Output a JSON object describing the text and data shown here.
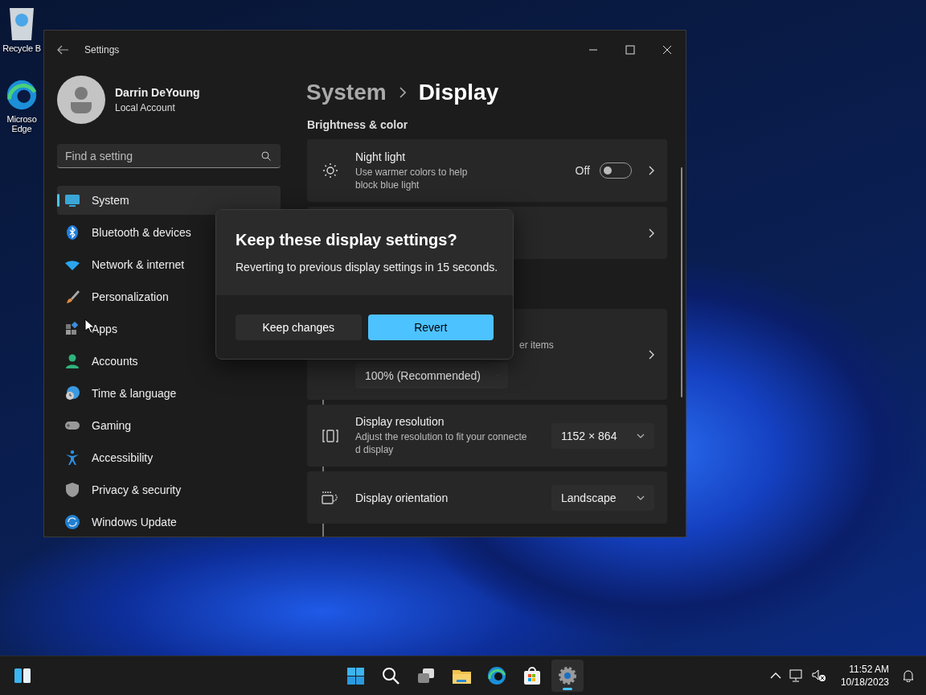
{
  "desktop_icons": [
    {
      "label": "Recycle B"
    },
    {
      "label": "Microso\nEdge"
    }
  ],
  "window": {
    "title": "Settings"
  },
  "user": {
    "name": "Darrin DeYoung",
    "account_type": "Local Account"
  },
  "search": {
    "placeholder": "Find a setting"
  },
  "nav_items": [
    {
      "label": "System",
      "selected": true
    },
    {
      "label": "Bluetooth & devices",
      "selected": false
    },
    {
      "label": "Network & internet",
      "selected": false
    },
    {
      "label": "Personalization",
      "selected": false
    },
    {
      "label": "Apps",
      "selected": false
    },
    {
      "label": "Accounts",
      "selected": false
    },
    {
      "label": "Time & language",
      "selected": false
    },
    {
      "label": "Gaming",
      "selected": false
    },
    {
      "label": "Accessibility",
      "selected": false
    },
    {
      "label": "Privacy & security",
      "selected": false
    },
    {
      "label": "Windows Update",
      "selected": false
    }
  ],
  "breadcrumb": [
    "System",
    "Display"
  ],
  "section_title": "Brightness & color",
  "cards": [
    {
      "kind": "toggle",
      "title": "Night light",
      "description": "Use warmer colors to help\nblock blue light",
      "state_label": "Off",
      "on": false
    },
    {
      "kind": "link"
    },
    {
      "kind": "scale",
      "description": "er items",
      "dropdown": "100% (Recommended)"
    },
    {
      "kind": "dropdown",
      "title": "Display resolution",
      "description": "Adjust the resolution to fit your connecte\nd display",
      "dropdown": "1152 × 864"
    },
    {
      "kind": "dropdown",
      "title": "Display orientation",
      "dropdown": "Landscape"
    }
  ],
  "dialog": {
    "title": "Keep these display settings?",
    "message": "Reverting to previous display settings in 15 seconds.",
    "buttons": [
      {
        "label": "Keep changes",
        "kind": "secondary"
      },
      {
        "label": "Revert",
        "kind": "primary"
      }
    ]
  },
  "taskbar": {
    "apps": [
      {
        "selected": false
      },
      {
        "selected": false
      },
      {
        "selected": false
      },
      {
        "selected": false
      },
      {
        "selected": false
      },
      {
        "selected": false
      },
      {
        "selected": true
      }
    ],
    "time": "11:52 AM",
    "date": "10/18/2023"
  }
}
